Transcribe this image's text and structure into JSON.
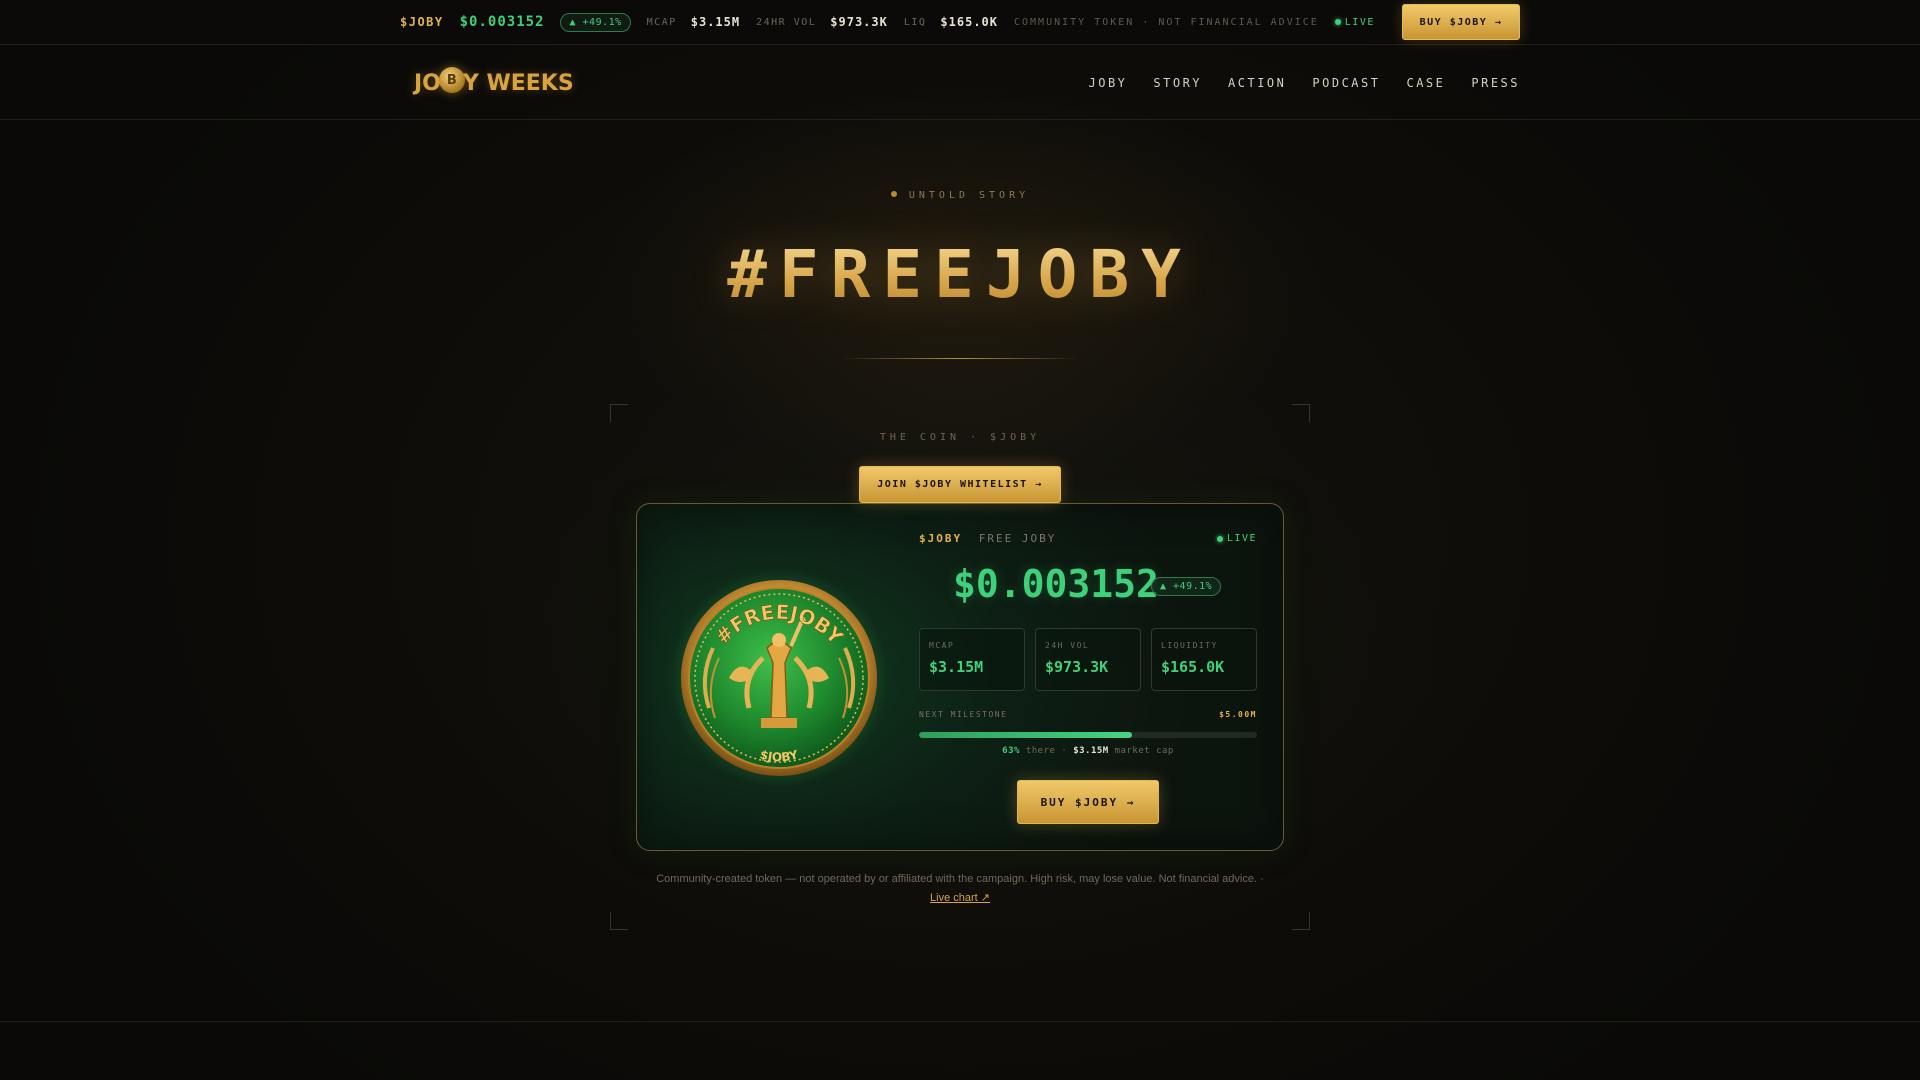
{
  "ticker": {
    "symbol": "$JOBY",
    "price": "$0.003152",
    "change": "▲ +49.1%",
    "mcap_label": "MCAP",
    "mcap_value": "$3.15M",
    "vol_label": "24HR VOL",
    "vol_value": "$973.3K",
    "liq_label": "LIQ",
    "liq_value": "$165.0K",
    "note": "COMMUNITY TOKEN · NOT FINANCIAL ADVICE",
    "live": "LIVE",
    "buy_label": "BUY $JOBY →"
  },
  "nav": {
    "logo_left": "JO",
    "logo_coin": "B",
    "logo_right": "Y WEEKS",
    "links": [
      "JOBY",
      "STORY",
      "ACTION",
      "PODCAST",
      "CASE",
      "PRESS"
    ]
  },
  "hero": {
    "eyebrow": "UNTOLD STORY",
    "title": "#FREEJOBY"
  },
  "coin_section": {
    "label": "THE COIN · $JOBY",
    "whitelist_label": "JOIN $JOBY WHITELIST →",
    "card": {
      "symbol": "$JOBY",
      "name": "FREE JOBY",
      "live": "LIVE",
      "price": "$0.003152",
      "change": "▲ +49.1%",
      "stats": [
        {
          "label": "MCAP",
          "value": "$3.15M"
        },
        {
          "label": "24H VOL",
          "value": "$973.3K"
        },
        {
          "label": "LIQUIDITY",
          "value": "$165.0K"
        }
      ],
      "milestone_label": "NEXT MILESTONE",
      "milestone_value": "$5.00M",
      "progress_fraction": 0.63,
      "progress_pct": "63%",
      "progress_mid": "there ·",
      "progress_mcap": "$3.15M",
      "progress_suffix": "market cap",
      "buy_label": "BUY $JOBY →"
    },
    "disclaimer": "Community-created token — not operated by or affiliated with the campaign. High risk, may lose value. Not financial advice. ·",
    "chart_link": "Live chart ↗"
  },
  "colors": {
    "gold": "#e3b24a",
    "green": "#3fd07a",
    "background": "#0b0a08"
  }
}
